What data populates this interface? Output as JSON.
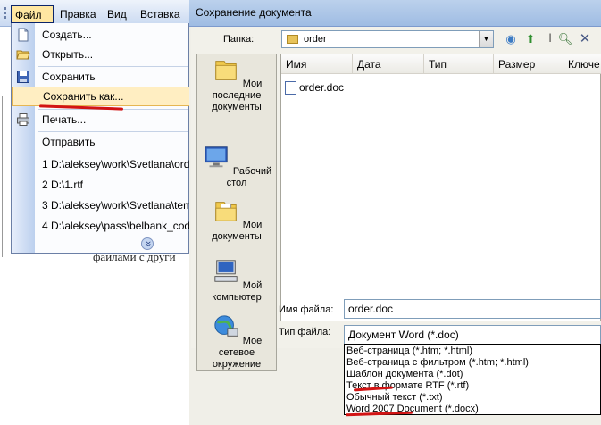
{
  "word": {
    "menubar": {
      "items": [
        "Файл",
        "Правка",
        "Вид",
        "Вставка"
      ]
    },
    "file_menu": {
      "items": [
        {
          "label": "Создать...",
          "icon": "new-doc-icon"
        },
        {
          "label": "Открыть...",
          "icon": "open-folder-icon"
        },
        {
          "label": "Сохранить",
          "icon": "save-disk-icon"
        },
        {
          "label": "Сохранить как...",
          "icon": ""
        },
        {
          "label": "Печать...",
          "icon": "print-icon"
        },
        {
          "label": "Отправить",
          "icon": ""
        }
      ],
      "recent": [
        "1 D:\\aleksey\\work\\Svetlana\\ord",
        "2 D:\\1.rtf",
        "3 D:\\aleksey\\work\\Svetlana\\tem",
        "4 D:\\aleksey\\pass\\belbank_code"
      ],
      "expand_symbol": "»",
      "highlighted": "Сохранить как..."
    },
    "doc_fragment": "файлами с други"
  },
  "dialog": {
    "title": "Сохранение документа",
    "folder_label": "Папка:",
    "folder_value": "order",
    "places": [
      {
        "label": "Мои последние документы",
        "icon": "recent-folder-icon"
      },
      {
        "label": "Рабочий стол",
        "icon": "desktop-icon"
      },
      {
        "label": "Мои документы",
        "icon": "my-documents-icon"
      },
      {
        "label": "Мой компьютер",
        "icon": "my-computer-icon"
      },
      {
        "label": "Мое сетевое окружение",
        "icon": "network-icon"
      }
    ],
    "columns": [
      "Имя",
      "Дата",
      "Тип",
      "Размер",
      "Ключе"
    ],
    "files": [
      {
        "name": "order.doc"
      }
    ],
    "filename_label": "Имя файла:",
    "filename_value": "order.doc",
    "filetype_label": "Тип файла:",
    "filetype_value": "Документ Word (*.doc)",
    "filetype_options": [
      "Веб-страница (*.htm; *.html)",
      "Веб-страница с фильтром (*.htm; *.html)",
      "Шаблон документа (*.dot)",
      "Текст в формате RTF (*.rtf)",
      "Обычный текст (*.txt)",
      "Word 2007 Document (*.docx)"
    ]
  },
  "colors": {
    "annotation": "#d21414",
    "menu_highlight": "#ffeec2",
    "title_bar": "#a9c4e8"
  }
}
